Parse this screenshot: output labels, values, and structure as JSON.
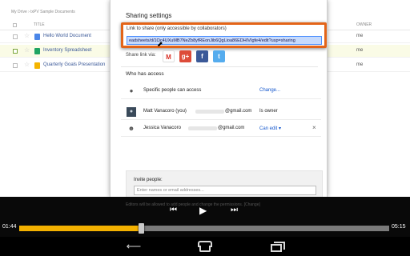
{
  "drive": {
    "breadcrumb": "My Drive  ›  txPV Sample Documents",
    "column_title": "TITLE",
    "column_owner": "OWNER",
    "files": [
      {
        "name": "Hello World Document",
        "owner": "me",
        "type_icon": "document-icon",
        "color": "#4a86e8",
        "selected": false
      },
      {
        "name": "Inventory Spreadsheet",
        "owner": "me",
        "type_icon": "spreadsheet-icon",
        "color": "#1fa463",
        "selected": true
      },
      {
        "name": "Quarterly Goals Presentation",
        "owner": "me",
        "type_icon": "presentation-icon",
        "color": "#f4b400",
        "selected": false
      }
    ]
  },
  "sharing": {
    "title": "Sharing settings",
    "link_label": "Link to share (only accessible by collaborators)",
    "link_value": "eadsheets/d/1Oc4UXuMB7NeZb8yfREonJib6QgLioa86EDHIVIgfe4/edit?usp=sharing",
    "share_via_label": "Share link via:",
    "social_icons": [
      "gmail-icon",
      "google-plus-icon",
      "facebook-icon",
      "twitter-icon"
    ],
    "social_glyphs": {
      "gmail": "M",
      "gplus": "g+",
      "facebook": "f",
      "twitter": "t"
    },
    "who_has_access": "Who has access",
    "access": [
      {
        "name": "Specific people can access",
        "right": "Change...",
        "icon": "lock-icon"
      },
      {
        "name": "Matt Vanacoro (you)",
        "domain": "@gmail.com",
        "right": "Is owner",
        "icon": "avatar-photo"
      },
      {
        "name": "Jessica Vanacoro",
        "domain": "@gmail.com",
        "right": "Can edit ▾",
        "icon": "person-icon",
        "remove": "×"
      }
    ],
    "invite_label": "Invite people:",
    "invite_placeholder": "Enter names or email addresses...",
    "hint_text": "Editors will be allowed to add people and change the permissions. [Change]"
  },
  "player": {
    "current_time": "01:44",
    "total_time": "05:15",
    "progress": 0.33,
    "accent_color": "#f3b100",
    "prev_icon": "⏮",
    "play_icon": "▶",
    "next_icon": "⏭"
  },
  "navbar": {
    "back_glyph": "⟵"
  }
}
